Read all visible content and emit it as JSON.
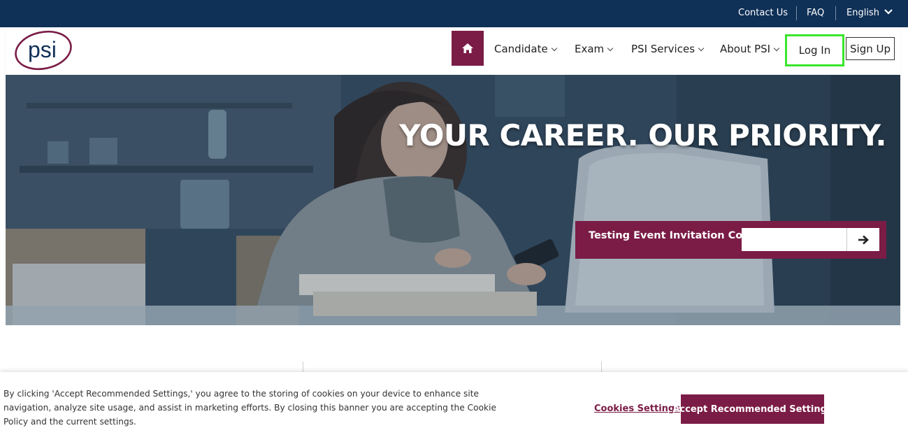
{
  "topbar": {
    "contact": "Contact Us",
    "faq": "FAQ",
    "language": "English"
  },
  "logo": {
    "text": "psi"
  },
  "nav": {
    "items": [
      {
        "label": "Candidate"
      },
      {
        "label": "Exam"
      },
      {
        "label": "PSI Services"
      },
      {
        "label": "About PSI"
      }
    ],
    "login": "Log In",
    "signup": "Sign Up"
  },
  "hero": {
    "title": "YOUR CAREER. OUR PRIORITY.",
    "code_label": "Testing Event Invitation Code",
    "code_value": ""
  },
  "cookie": {
    "text": "By clicking 'Accept Recommended Settings,' you agree to the storing of cookies on your device to enhance site navigation, analyze site usage, and assist in marketing efforts. By closing this banner you are accepting the Cookie Policy and the current settings.",
    "settings": "Cookies Settings",
    "accept": "Accept Recommended Settings"
  },
  "colors": {
    "topbar": "#0f3057",
    "brand": "#7a1c46",
    "focus_outline": "#39e62b"
  },
  "icons": {
    "home": "home-icon",
    "go": "arrow-right-icon",
    "language": "chevron-down-icon"
  }
}
